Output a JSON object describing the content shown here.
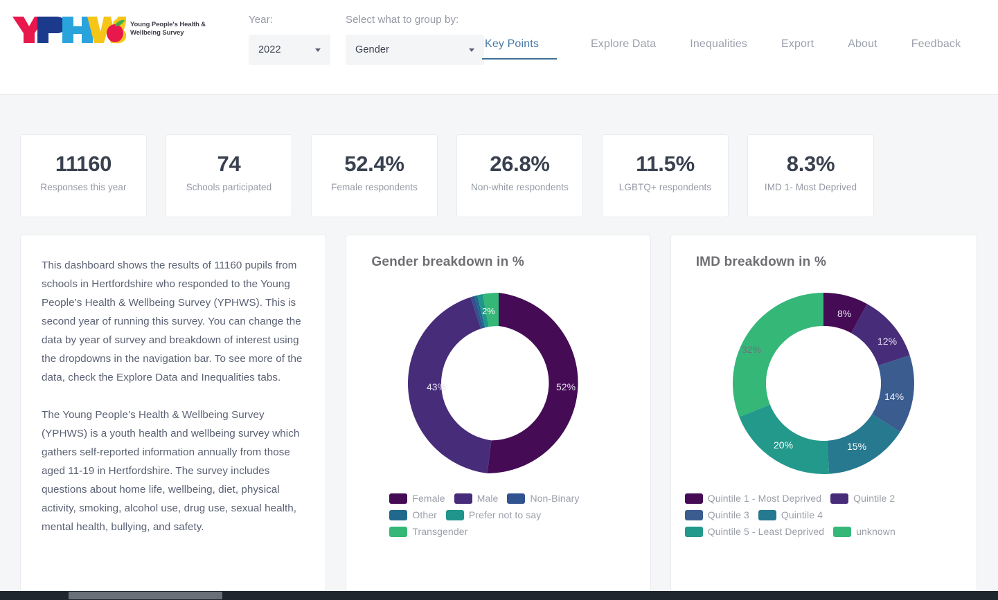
{
  "header": {
    "logo": {
      "mark_letters": "YPHWS",
      "tagline_line1": "Young People's Health &",
      "tagline_line2": "Wellbeing Survey",
      "colors": {
        "y": "#e8174c",
        "p": "#1b3a8c",
        "h": "#1b3a8c",
        "w": "#29a3dc",
        "s": "#f5c518",
        "apple": "#e8174c",
        "leaf": "#3fae49"
      }
    },
    "year_label": "Year:",
    "year_value": "2022",
    "group_label": "Select what to group by:",
    "group_value": "Gender",
    "tabs": [
      {
        "label": "Key Points",
        "active": true
      },
      {
        "label": "Explore Data",
        "active": false
      },
      {
        "label": "Inequalities",
        "active": false
      },
      {
        "label": "Export",
        "active": false
      },
      {
        "label": "About",
        "active": false
      },
      {
        "label": "Feedback",
        "active": false
      }
    ],
    "active_tab_color": "#4679a8"
  },
  "kpis": [
    {
      "value": "11160",
      "label": "Responses this year"
    },
    {
      "value": "74",
      "label": "Schools participated"
    },
    {
      "value": "52.4%",
      "label": "Female respondents"
    },
    {
      "value": "26.8%",
      "label": "Non-white respondents"
    },
    {
      "value": "11.5%",
      "label": "LGBTQ+ respondents"
    },
    {
      "value": "8.3%",
      "label": "IMD 1- Most Deprived"
    }
  ],
  "about": {
    "paragraph1": "This dashboard shows the results of 11160 pupils from schools in Hertfordshire who responded to the Young People’s Health & Wellbeing Survey (YPHWS). This is second year of running this survey. You can change the data by year of survey and breakdown of interest using the dropdowns in the navigation bar. To see more of the data, check the Explore Data and Inequalities tabs.",
    "paragraph2": "The Young People’s Health & Wellbeing Survey (YPHWS) is a youth health and wellbeing survey which gathers self-reported information annually from those aged 11-19 in Hertfordshire. The survey includes questions about home life, wellbeing, diet, physical activity, smoking, alcohol use, drug use, sexual health, mental health, bullying, and safety."
  },
  "chart_data": [
    {
      "type": "pie",
      "variant": "donut",
      "title": "Gender breakdown in %",
      "xlabel": "",
      "ylabel": "",
      "legend_position": "bottom",
      "units": "%",
      "categories": [
        "Female",
        "Male",
        "Non-Binary",
        "Other",
        "Prefer not to say",
        "Transgender"
      ],
      "values": [
        52,
        43,
        0.7,
        0.5,
        1,
        2
      ],
      "labels_shown": [
        "52%",
        "43%",
        "",
        "",
        "",
        "2%"
      ],
      "colors": [
        "#450b55",
        "#472c7a",
        "#31538f",
        "#21688d",
        "#1f958b",
        "#35b778"
      ]
    },
    {
      "type": "pie",
      "variant": "donut",
      "title": "IMD breakdown in %",
      "xlabel": "",
      "ylabel": "",
      "legend_position": "bottom",
      "units": "%",
      "categories": [
        "Quintile 1 - Most Deprived",
        "Quintile 2",
        "Quintile 3",
        "Quintile 4",
        "Quintile 5 - Least Deprived",
        "unknown"
      ],
      "values": [
        8,
        12,
        14,
        15,
        20,
        32
      ],
      "labels_shown": [
        "8%",
        "12%",
        "14%",
        "15%",
        "20%",
        "32%"
      ],
      "colors": [
        "#450b55",
        "#472c7a",
        "#3b5c8f",
        "#26798e",
        "#23998c",
        "#35b778"
      ]
    }
  ]
}
